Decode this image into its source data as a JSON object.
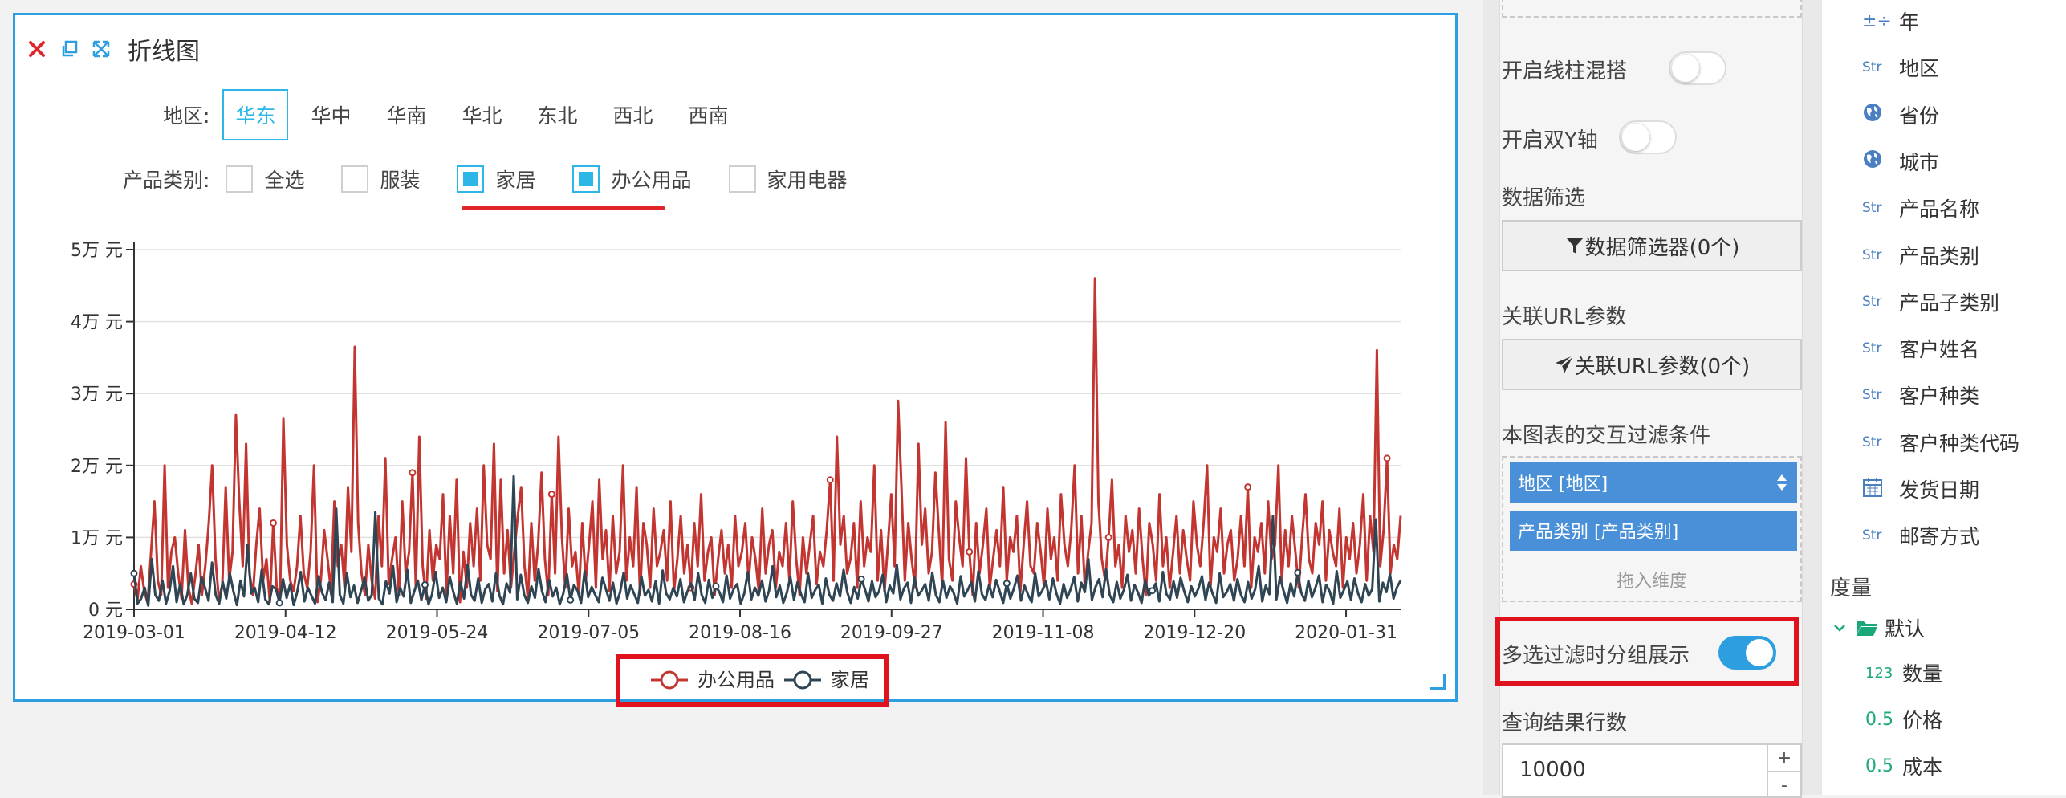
{
  "chart_card": {
    "title": "折线图",
    "region_label": "地区:",
    "regions": [
      "华东",
      "华中",
      "华南",
      "华北",
      "东北",
      "西北",
      "西南"
    ],
    "active_region": "华东",
    "category_label": "产品类别:",
    "categories": [
      {
        "label": "全选",
        "checked": false
      },
      {
        "label": "服装",
        "checked": false
      },
      {
        "label": "家居",
        "checked": true
      },
      {
        "label": "办公用品",
        "checked": true
      },
      {
        "label": "家用电器",
        "checked": false
      }
    ]
  },
  "chart_data": {
    "type": "line",
    "title": "",
    "xlabel": "",
    "ylabel": "",
    "ylim": [
      0,
      50000
    ],
    "y_ticks": [
      "0 元",
      "1万 元",
      "2万 元",
      "3万 元",
      "4万 元",
      "5万 元"
    ],
    "x_ticks": [
      "2019-03-01",
      "2019-04-12",
      "2019-05-24",
      "2019-07-05",
      "2019-08-16",
      "2019-09-27",
      "2019-11-08",
      "2019-12-20",
      "2020-01-31"
    ],
    "x_range": [
      "2019-03-01",
      "2020-02-14"
    ],
    "grid": true,
    "legend_position": "bottom",
    "series": [
      {
        "name": "办公用品",
        "color": "#c23531",
        "values": [
          3500,
          1200,
          6000,
          2500,
          900,
          8000,
          15000,
          4000,
          2000,
          20000,
          3000,
          8000,
          10000,
          5000,
          1500,
          11000,
          3000,
          800,
          4500,
          9000,
          2000,
          6000,
          12000,
          20000,
          7000,
          1200,
          3500,
          17000,
          4000,
          8000,
          27000,
          15000,
          6000,
          23000,
          5000,
          2000,
          9000,
          14000,
          4000,
          7000,
          1000,
          12000,
          3000,
          1500,
          26500,
          9000,
          4000,
          2500,
          6000,
          13000,
          5000,
          3000,
          8000,
          20000,
          1000,
          4000,
          11000,
          7000,
          2500,
          15000,
          6000,
          9000,
          3000,
          17000,
          8000,
          36500,
          12000,
          5000,
          2000,
          9000,
          4000,
          1500,
          13000,
          6000,
          21000,
          3500,
          7000,
          10000,
          2000,
          15000,
          5000,
          8000,
          19000,
          3000,
          24000,
          6000,
          1500,
          11000,
          4000,
          9000,
          7000,
          16000,
          2000,
          13000,
          5000,
          18000,
          1000,
          8000,
          3000,
          12000,
          6000,
          14000,
          4000,
          20000,
          9000,
          7000,
          23000,
          2500,
          18000,
          5000,
          11000,
          3000,
          8000,
          13000,
          17000,
          6000,
          1500,
          12000,
          4000,
          9000,
          19000,
          7000,
          2000,
          16000,
          5000,
          24000,
          10000,
          3000,
          14000,
          6000,
          8000,
          2000,
          12000,
          4000,
          9000,
          15000,
          3000,
          18000,
          7000,
          11000,
          2500,
          13000,
          5000,
          8000,
          20000,
          4000,
          10000,
          6000,
          17000,
          2000,
          12000,
          9000,
          3000,
          14000,
          6000,
          8000,
          11000,
          4000,
          15000,
          2500,
          7000,
          13000,
          5000,
          9000,
          3000,
          12000,
          6000,
          16000,
          4000,
          8000,
          10000,
          2000,
          7000,
          11000,
          5000,
          9000,
          3000,
          13000,
          6000,
          8000,
          12000,
          4000,
          10000,
          7000,
          2500,
          14000,
          5000,
          9000,
          11000,
          3000,
          8000,
          6000,
          12000,
          4000,
          15000,
          7000,
          2000,
          10000,
          5000,
          9000,
          13000,
          3500,
          8000,
          6000,
          11000,
          18000,
          4000,
          24000,
          9000,
          13000,
          5000,
          7000,
          12000,
          3000,
          15000,
          6000,
          10000,
          8000,
          20000,
          4000,
          11000,
          2500,
          9000,
          16000,
          6000,
          29000,
          17000,
          4000,
          12000,
          7000,
          3000,
          23000,
          9000,
          14000,
          5000,
          8000,
          19000,
          11000,
          3000,
          26000,
          7000,
          4000,
          15000,
          10000,
          6000,
          21000,
          8000,
          2000,
          12000,
          5000,
          9000,
          14000,
          3000,
          7000,
          11000,
          6000,
          17000,
          4000,
          10000,
          8000,
          13000,
          2500,
          9000,
          15000,
          6000,
          5000,
          12000,
          8000,
          3000,
          14000,
          7000,
          10000,
          4000,
          16000,
          9000,
          6000,
          11000,
          20000,
          5000,
          13000,
          3000,
          8000,
          12000,
          46000,
          15000,
          7000,
          4000,
          10000,
          18000,
          6000,
          9000,
          3000,
          13000,
          8000,
          11000,
          5000,
          14000,
          7000,
          2000,
          12000,
          9000,
          4000,
          16000,
          6000,
          10000,
          3000,
          8000,
          13000,
          5000,
          11000,
          7000,
          4000,
          15000,
          9000,
          6000,
          12000,
          20000,
          3000,
          10000,
          8000,
          14000,
          5000,
          9000,
          11000,
          4000,
          7000,
          13000,
          6000,
          17000,
          3000,
          10000,
          8000,
          12000,
          5000,
          15000,
          7000,
          9000,
          20000,
          4000,
          11000,
          6000,
          13000,
          8000,
          3000,
          10000,
          16000,
          7000,
          5000,
          12000,
          9000,
          15000,
          4000,
          11000,
          8000,
          6000,
          14000,
          3000,
          10000,
          7000,
          12000,
          5000,
          9000,
          16000,
          4000,
          13000,
          8000,
          36000,
          6000,
          11000,
          21000,
          5000,
          9000,
          7000,
          13000
        ]
      },
      {
        "name": "家居",
        "color": "#2f4554",
        "values": [
          5000,
          800,
          1500,
          3000,
          500,
          7000,
          2000,
          1200,
          4000,
          800,
          2500,
          6000,
          1000,
          3500,
          700,
          2000,
          5000,
          1500,
          900,
          4500,
          3000,
          1200,
          6500,
          2000,
          800,
          3800,
          1500,
          5000,
          2500,
          600,
          4000,
          1800,
          9000,
          2200,
          3000,
          1000,
          5500,
          1400,
          700,
          3200,
          2800,
          900,
          4200,
          1600,
          3500,
          600,
          2400,
          5200,
          1100,
          3000,
          1900,
          800,
          4600,
          2300,
          1300,
          3700,
          1000,
          14000,
          2000,
          800,
          5000,
          1700,
          3300,
          900,
          2600,
          4400,
          1200,
          2000,
          13500,
          1500,
          700,
          3900,
          2200,
          6000,
          1000,
          3000,
          1800,
          5500,
          900,
          2500,
          4000,
          1300,
          3400,
          700,
          2100,
          5200,
          1600,
          3000,
          1000,
          4500,
          2400,
          800,
          3800,
          1500,
          6200,
          2000,
          1200,
          4300,
          900,
          2800,
          3500,
          1100,
          5000,
          1900,
          700,
          3600,
          2300,
          18500,
          1400,
          4800,
          2000,
          900,
          3200,
          1600,
          5600,
          2500,
          1000,
          4100,
          1800,
          3000,
          700,
          2200,
          4900,
          1300,
          3400,
          2600,
          900,
          5300,
          1700,
          3100,
          2000,
          1000,
          4400,
          2800,
          1200,
          3700,
          800,
          2400,
          5100,
          1500,
          3300,
          2100,
          900,
          4600,
          1900,
          2700,
          1100,
          3900,
          800,
          5400,
          2200,
          1400,
          3000,
          1800,
          4200,
          1000,
          2500,
          3600,
          1300,
          5000,
          2000,
          900,
          4100,
          1600,
          3200,
          2400,
          1000,
          4700,
          1500,
          2800,
          3500,
          800,
          2200,
          5200,
          1400,
          3000,
          1900,
          4000,
          1100,
          2600,
          6000,
          1700,
          3300,
          900,
          2300,
          4500,
          1300,
          3800,
          2100,
          1000,
          5000,
          1600,
          2700,
          3400,
          800,
          4300,
          2000,
          1200,
          3600,
          1800,
          5500,
          2400,
          900,
          3100,
          1500,
          4200,
          2800,
          1100,
          3900,
          1700,
          2500,
          4800,
          1000,
          3300,
          2200,
          6200,
          1400,
          2900,
          3700,
          900,
          4400,
          1900,
          2600,
          3500,
          1200,
          5100,
          2000,
          1000,
          4000,
          1600,
          3200,
          2300,
          800,
          4600,
          1800,
          2700,
          3800,
          1100,
          5300,
          2100,
          1300,
          3400,
          1700,
          4100,
          2500,
          900,
          3600,
          1500,
          2900,
          4700,
          1200,
          3300,
          2000,
          1000,
          5000,
          1800,
          2600,
          3900,
          1400,
          4300,
          2200,
          800,
          3500,
          1600,
          2800,
          4500,
          1100,
          3700,
          2400,
          7000,
          1300,
          3100,
          4200,
          1700,
          5600,
          2000,
          1000,
          3800,
          1500,
          2700,
          4800,
          1200,
          3400,
          2300,
          900,
          4100,
          1900,
          2600,
          3600,
          1100,
          5200,
          2100,
          1400,
          3900,
          1600,
          4400,
          2500,
          1000,
          3200,
          1800,
          2900,
          4600,
          1300,
          3700,
          2200,
          900,
          5000,
          1700,
          2400,
          3500,
          1200,
          4200,
          2000,
          1000,
          3800,
          1500,
          2800,
          6000,
          1100,
          3300,
          2100,
          13000,
          1400,
          4500,
          2600,
          900,
          3600,
          1800,
          5100,
          2300,
          1200,
          4000,
          1700,
          3000,
          4700,
          1000,
          3400,
          2500,
          800,
          5300,
          1600,
          2700,
          3900,
          1300,
          4300,
          2200,
          1000,
          3500,
          1900,
          2800,
          12500,
          1100,
          3700,
          2400,
          4900,
          1500,
          3100,
          4000
        ]
      }
    ]
  },
  "legend": {
    "items": [
      "办公用品",
      "家居"
    ]
  },
  "props": {
    "mix_line_bar_label": "开启线柱混搭",
    "dual_y_label": "开启双Y轴",
    "data_filter_label": "数据筛选",
    "data_filter_btn": "数据筛选器(0个)",
    "url_params_label": "关联URL参数",
    "url_params_btn": "关联URL参数(0个)",
    "interaction_label": "本图表的交互过滤条件",
    "dim_chip_1": "地区 [地区]",
    "dim_chip_2": "产品类别 [产品类别]",
    "drop_hint": "拖入维度",
    "multi_group_label": "多选过滤时分组展示",
    "multi_group_on": true,
    "rows_label": "查询结果行数",
    "rows_value": "10000",
    "stepper_plus": "+",
    "stepper_minus": "-"
  },
  "fields": {
    "dimensions": [
      {
        "type": "calc",
        "type_text": "±÷",
        "label": "年"
      },
      {
        "type": "Str",
        "type_text": "Str",
        "label": "地区"
      },
      {
        "type": "geo",
        "type_text": "",
        "label": "省份"
      },
      {
        "type": "geo",
        "type_text": "",
        "label": "城市"
      },
      {
        "type": "Str",
        "type_text": "Str",
        "label": "产品名称"
      },
      {
        "type": "Str",
        "type_text": "Str",
        "label": "产品类别"
      },
      {
        "type": "Str",
        "type_text": "Str",
        "label": "产品子类别"
      },
      {
        "type": "Str",
        "type_text": "Str",
        "label": "客户姓名"
      },
      {
        "type": "Str",
        "type_text": "Str",
        "label": "客户种类"
      },
      {
        "type": "Str",
        "type_text": "Str",
        "label": "客户种类代码"
      },
      {
        "type": "date",
        "type_text": "",
        "label": "发货日期"
      },
      {
        "type": "Str",
        "type_text": "Str",
        "label": "邮寄方式"
      }
    ],
    "measures_title": "度量",
    "measure_group": "默认",
    "measures": [
      {
        "type_text": "123",
        "label": "数量"
      },
      {
        "type_text": "0.5",
        "label": "价格"
      },
      {
        "type_text": "0.5",
        "label": "成本"
      }
    ]
  }
}
